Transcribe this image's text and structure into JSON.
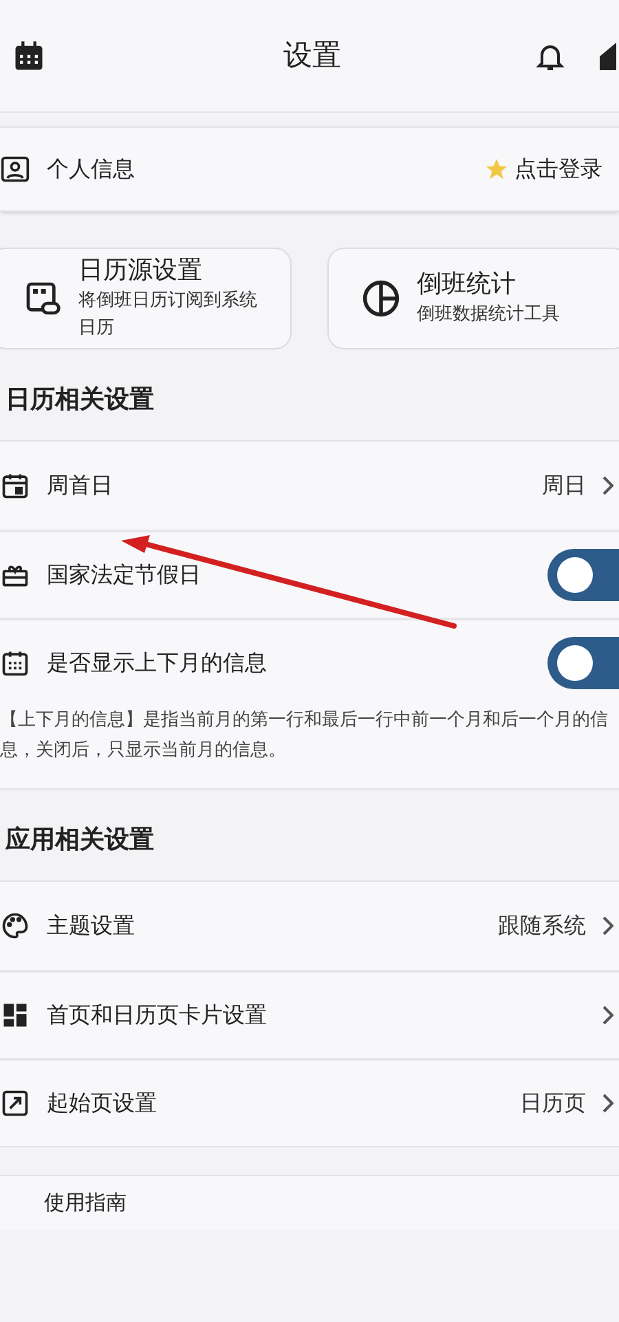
{
  "header": {
    "title": "设置"
  },
  "profile": {
    "label": "个人信息",
    "action": "点击登录"
  },
  "cards": [
    {
      "title": "日历源设置",
      "subtitle": "将倒班日历订阅到系统日历",
      "kind": "source"
    },
    {
      "title": "倒班统计",
      "subtitle": "倒班数据统计工具",
      "kind": "stats"
    }
  ],
  "sections": [
    {
      "title": "日历相关设置",
      "rows": [
        {
          "kind": "value",
          "label": "周首日",
          "value": "周日"
        },
        {
          "kind": "toggle",
          "label": "国家法定节假日",
          "on": true
        },
        {
          "kind": "toggle",
          "label": "是否显示上下月的信息",
          "on": true
        }
      ],
      "note": "【上下月的信息】是指当前月的第一行和最后一行中前一个月和后一个月的信息，关闭后，只显示当前月的信息。"
    },
    {
      "title": "应用相关设置",
      "rows": [
        {
          "kind": "value",
          "label": "主题设置",
          "value": "跟随系统"
        },
        {
          "kind": "value",
          "label": "首页和日历页卡片设置"
        },
        {
          "kind": "value",
          "label": "起始页设置",
          "value": "日历页"
        }
      ]
    }
  ],
  "footer": {
    "label": "使用指南"
  }
}
